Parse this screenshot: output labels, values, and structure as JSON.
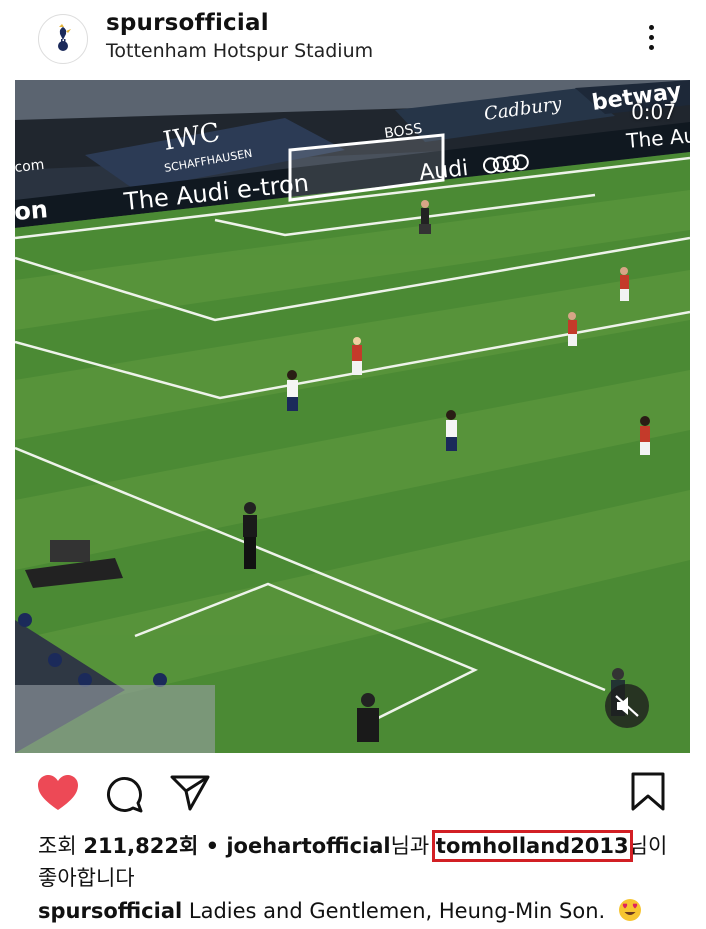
{
  "header": {
    "username": "spursofficial",
    "location": "Tottenham Hotspur Stadium"
  },
  "video": {
    "timer": "0:07",
    "ads": {
      "audi_etron": "The Audi e-tron",
      "audi": "Audi",
      "audi_right": "The Au",
      "iwc": "IWC",
      "iwc_sub": "SCHAFFHAUSEN",
      "cadbury": "Cadbury",
      "boss": "BOSS",
      "betway": "betway",
      "com": "com",
      "on": "on"
    }
  },
  "actions": {
    "like_icon": "heart-icon",
    "comment_icon": "comment-icon",
    "share_icon": "send-icon",
    "save_icon": "bookmark-icon",
    "like_color": "#ed4956"
  },
  "likes": {
    "views_label": "조회",
    "views_count": "211,822회",
    "separator": " • ",
    "user1": "joehartofficial",
    "conj": "님과 ",
    "user2": "tomholland2013",
    "suffix": "님이",
    "suffix2": "좋아합니다"
  },
  "caption": {
    "username": "spursofficial",
    "text": "Ladies and Gentlemen, Heung-Min Son.",
    "emoji": "heart-eyes-emoji"
  },
  "highlight_color": "#d21f24"
}
